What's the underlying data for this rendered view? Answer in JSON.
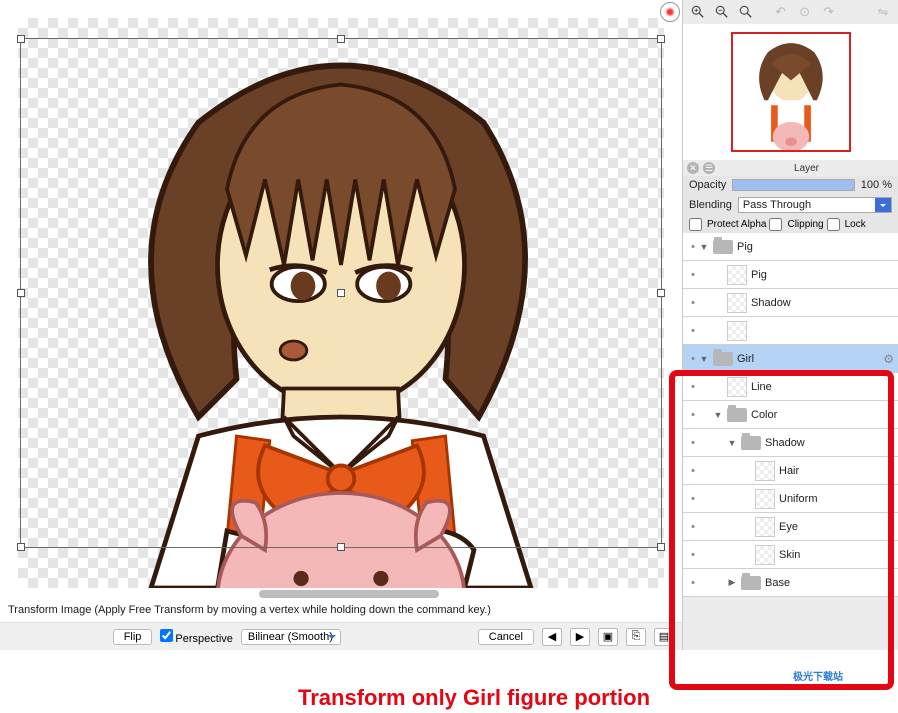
{
  "status_text": "Transform Image (Apply Free Transform by moving a vertex while holding down the command key.)",
  "bottombar": {
    "flip_label": "Flip",
    "perspective_label": "Perspective",
    "interp_label": "Bilinear (Smooth)",
    "cancel_label": "Cancel"
  },
  "panel": {
    "title": "Layer",
    "opacity_label": "Opacity",
    "opacity_value": "100 %",
    "blending_label": "Blending",
    "blending_value": "Pass Through",
    "protect_alpha": "Protect Alpha",
    "clipping": "Clipping",
    "lock": "Lock"
  },
  "layers": [
    {
      "id": "pig-folder",
      "name": "Pig",
      "type": "folder",
      "indent": 0,
      "arrow": "▼"
    },
    {
      "id": "pig-layer",
      "name": "Pig",
      "type": "layer",
      "indent": 1,
      "arrow": ""
    },
    {
      "id": "shadow1",
      "name": "Shadow",
      "type": "layer",
      "indent": 1,
      "arrow": ""
    },
    {
      "id": "clip1",
      "name": "",
      "type": "layer",
      "indent": 1,
      "arrow": ""
    },
    {
      "id": "girl-folder",
      "name": "Girl",
      "type": "folder",
      "indent": 0,
      "arrow": "▼",
      "selected": true,
      "gear": true
    },
    {
      "id": "line",
      "name": "Line",
      "type": "layer",
      "indent": 1,
      "arrow": ""
    },
    {
      "id": "color",
      "name": "Color",
      "type": "folder",
      "indent": 1,
      "arrow": "▼"
    },
    {
      "id": "shadow2",
      "name": "Shadow",
      "type": "folder",
      "indent": 2,
      "arrow": "▼"
    },
    {
      "id": "hair",
      "name": "Hair",
      "type": "layer",
      "indent": 3,
      "arrow": ""
    },
    {
      "id": "uniform",
      "name": "Uniform",
      "type": "layer",
      "indent": 3,
      "arrow": ""
    },
    {
      "id": "eye",
      "name": "Eye",
      "type": "layer",
      "indent": 3,
      "arrow": ""
    },
    {
      "id": "skin",
      "name": "Skin",
      "type": "layer",
      "indent": 3,
      "arrow": ""
    },
    {
      "id": "base",
      "name": "Base",
      "type": "folder",
      "indent": 2,
      "arrow": "▶"
    }
  ],
  "annotation": "Transform only Girl figure portion"
}
